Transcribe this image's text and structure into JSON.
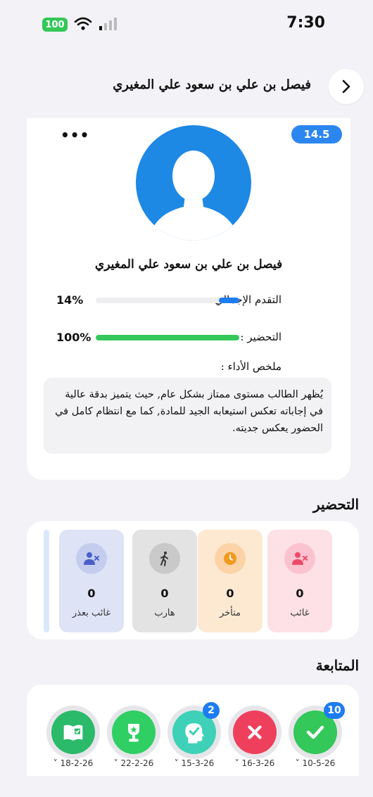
{
  "status_bar": {
    "battery": "100",
    "time": "7:30"
  },
  "header": {
    "title": "فيصل بن علي بن سعود علي المغيري"
  },
  "profile": {
    "score": "14.5",
    "more_label": "•••",
    "name": "فيصل بن علي بن سعود علي المغيري",
    "overall_progress_label": "التقدم الإجمالي :",
    "overall_progress_value": "14%",
    "overall_progress_fraction": 0.14,
    "preparation_label": "التحضير :",
    "preparation_value": "100%",
    "preparation_fraction": 1.0,
    "summary_label": "ملخص الأداء :",
    "summary_text": "يُظهر الطالب مستوى ممتاز بشكل عام, حيث يتميز بدقة عالية في إجاباته تعكس استيعابه الجيد للمادة, كما مع انتظام كامل في الحضور يعكس جديته."
  },
  "attendance": {
    "title": "التحضير",
    "items": [
      {
        "label": "غائب",
        "count": "0",
        "icon": "user-x-icon",
        "color": "#ee4a68",
        "bg": "#fde1e7",
        "circle": "#fbc3cf"
      },
      {
        "label": "متأخر",
        "count": "0",
        "icon": "clock-icon",
        "color": "#f29a1b",
        "bg": "#fde9d2",
        "circle": "#fbd3a6"
      },
      {
        "label": "هارب",
        "count": "0",
        "icon": "walking-icon",
        "color": "#333333",
        "bg": "#e3e3e3",
        "circle": "#c9c9c9"
      },
      {
        "label": "غائب بعذر",
        "count": "0",
        "icon": "user-x-icon",
        "color": "#4a5fc8",
        "bg": "#dfe3f6",
        "circle": "#c5cdef"
      }
    ]
  },
  "follow_up": {
    "title": "المتابعة",
    "items": [
      {
        "date": "10-5-26",
        "icon": "check-icon",
        "color": "#34c759",
        "badge": "10"
      },
      {
        "date": "16-3-26",
        "icon": "x-icon",
        "color": "#ee3f5c",
        "badge": ""
      },
      {
        "date": "15-3-26",
        "icon": "head-check-icon",
        "color": "#3ed1b7",
        "badge": "2"
      },
      {
        "date": "22-2-26",
        "icon": "trophy-icon",
        "color": "#2fcf63",
        "badge": ""
      },
      {
        "date": "18-2-26",
        "icon": "book-icon",
        "color": "#2bb96a",
        "badge": ""
      }
    ]
  }
}
